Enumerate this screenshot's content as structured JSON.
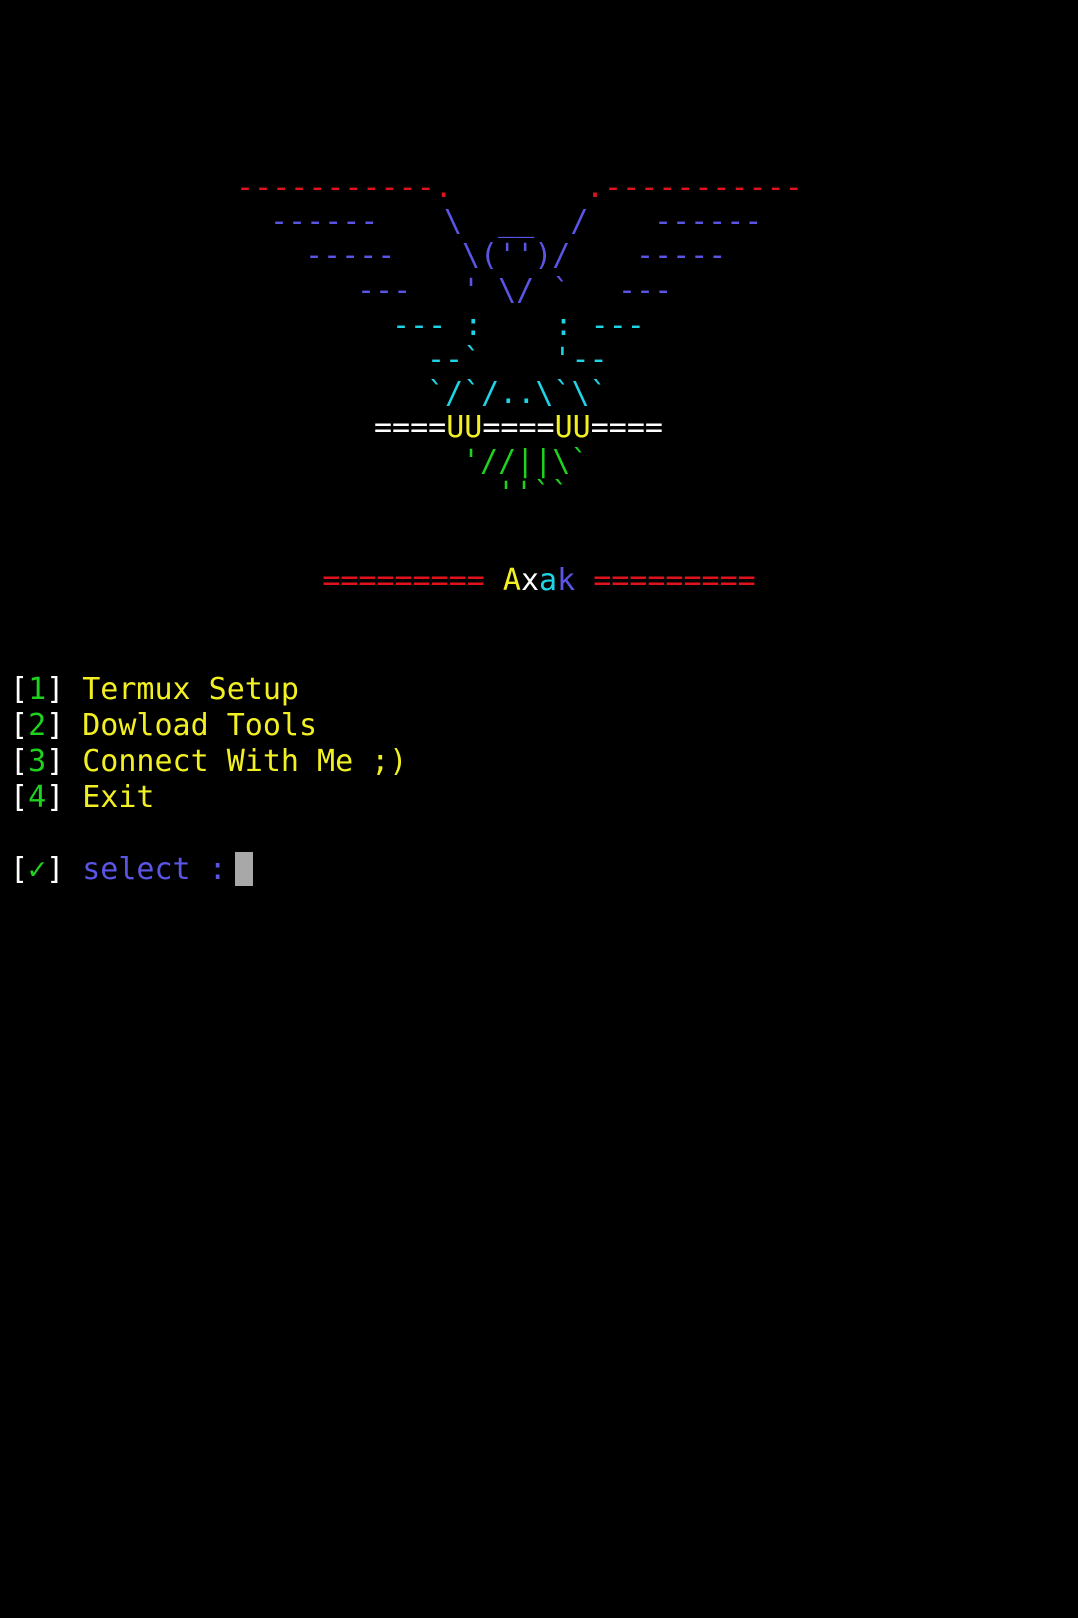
{
  "colors": {
    "red": "#e0131c",
    "blue": "#5b55e6",
    "cyan": "#1fd4e6",
    "white": "#ffffff",
    "yellow": "#f2f023",
    "green": "#1ed21e",
    "cursor": "#a8a8a8"
  },
  "art": {
    "line1_left": "-----------.",
    "line1_right": ".-----------",
    "line2_left": "------",
    "line2_mid": "\\  __  /",
    "line2_right": "------",
    "line3_left": "-----",
    "line3_mid": "\\('')/",
    "line3_right": "-----",
    "line4_left": "---",
    "line4_mid": "' \\/ `",
    "line4_right": "---",
    "line5": "--- :    : ---",
    "line6": "--`    '--",
    "line7": "`/`/..\\`\\`",
    "line8_a": "====",
    "line8_b": "UU",
    "line8_c": "====",
    "line8_d": "UU",
    "line8_e": "====",
    "line9": "'//||\\`",
    "line10": "''``"
  },
  "banner": {
    "left": "=========",
    "a": "A",
    "x": "x",
    "a2": "a",
    "k": "k",
    "right": "========="
  },
  "menu": {
    "items": [
      {
        "num": "1",
        "label": "Termux Setup"
      },
      {
        "num": "2",
        "label": "Dowload Tools"
      },
      {
        "num": "3",
        "label": "Connect With Me ;)"
      },
      {
        "num": "4",
        "label": "Exit"
      }
    ]
  },
  "prompt": {
    "mark": "✓",
    "text": "select :"
  }
}
